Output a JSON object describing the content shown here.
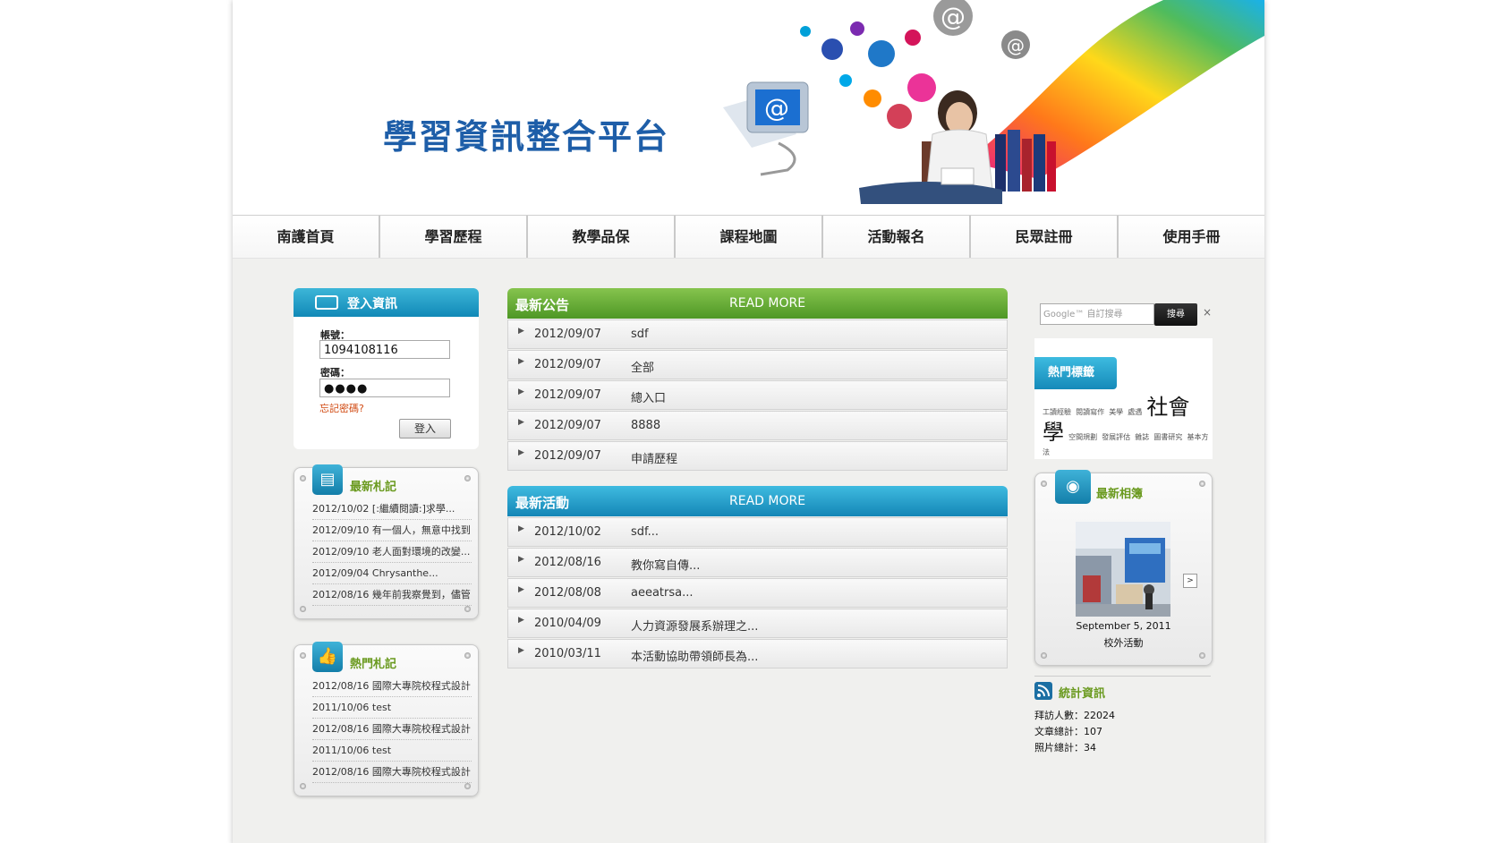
{
  "site": {
    "title": "學習資訊整合平台"
  },
  "nav": [
    "南護首頁",
    "學習歷程",
    "教學品保",
    "課程地圖",
    "活動報名",
    "民眾註冊",
    "使用手冊"
  ],
  "login": {
    "header": "登入資訊",
    "account_label": "帳號：",
    "account_value": "1094108116",
    "password_label": "密碼：",
    "password_value": "●●●●",
    "forgot": "忘記密碼?",
    "submit": "登入"
  },
  "latest_notes": {
    "title": "最新札記",
    "items": [
      "2012/10/02 [:繼續閱讀:]求學...",
      "2012/09/10 有一個人，無意中找到...",
      "2012/09/10 老人面對環境的改變...",
      "2012/09/04 Chrysanthe...",
      "2012/08/16 幾年前我察覺到，儘管..."
    ]
  },
  "hot_notes": {
    "title": "熱門札記",
    "items": [
      "2012/08/16 國際大專院校程式設計",
      "2011/10/06 test",
      "2012/08/16 國際大專院校程式設計",
      "2011/10/06 test",
      "2012/08/16 國際大專院校程式設計"
    ]
  },
  "announcements": {
    "title": "最新公告",
    "read_more": "READ MORE",
    "items": [
      {
        "date": "2012/09/07",
        "title": "sdf"
      },
      {
        "date": "2012/09/07",
        "title": "全部"
      },
      {
        "date": "2012/09/07",
        "title": "總入口"
      },
      {
        "date": "2012/09/07",
        "title": "8888"
      },
      {
        "date": "2012/09/07",
        "title": "申請歷程"
      }
    ]
  },
  "activities": {
    "title": "最新活動",
    "read_more": "READ MORE",
    "items": [
      {
        "date": "2012/10/02",
        "title": "sdf..."
      },
      {
        "date": "2012/08/16",
        "title": "教你寫自傳..."
      },
      {
        "date": "2012/08/08",
        "title": "aeeatrsa..."
      },
      {
        "date": "2010/04/09",
        "title": "人力資源發展系辦理之..."
      },
      {
        "date": "2010/03/11",
        "title": "本活動協助帶領師長為..."
      }
    ]
  },
  "search": {
    "placeholder": "Google™ 自訂搜尋",
    "button": "搜尋",
    "clear": "×"
  },
  "tags": {
    "title": "熱門標籤",
    "small_1": [
      "工讀經驗",
      "閱讀寫作",
      "美學",
      "處遇"
    ],
    "large_1": "社會學",
    "small_2": [
      "空間規劃",
      "發展評估",
      "雜誌",
      "圖書研究",
      "基本方法"
    ]
  },
  "album": {
    "title": "最新相簿",
    "date": "September 5, 2011",
    "caption": "校外活動",
    "next": ">"
  },
  "stats": {
    "title": "統計資訊",
    "visitors": "拜訪人數：22024",
    "articles": "文章總計：107",
    "photos": "照片總計：34"
  },
  "colors": {
    "accent_blue": "#1189b7",
    "accent_green": "#4e9725",
    "title_blue": "#1e5ea8"
  }
}
